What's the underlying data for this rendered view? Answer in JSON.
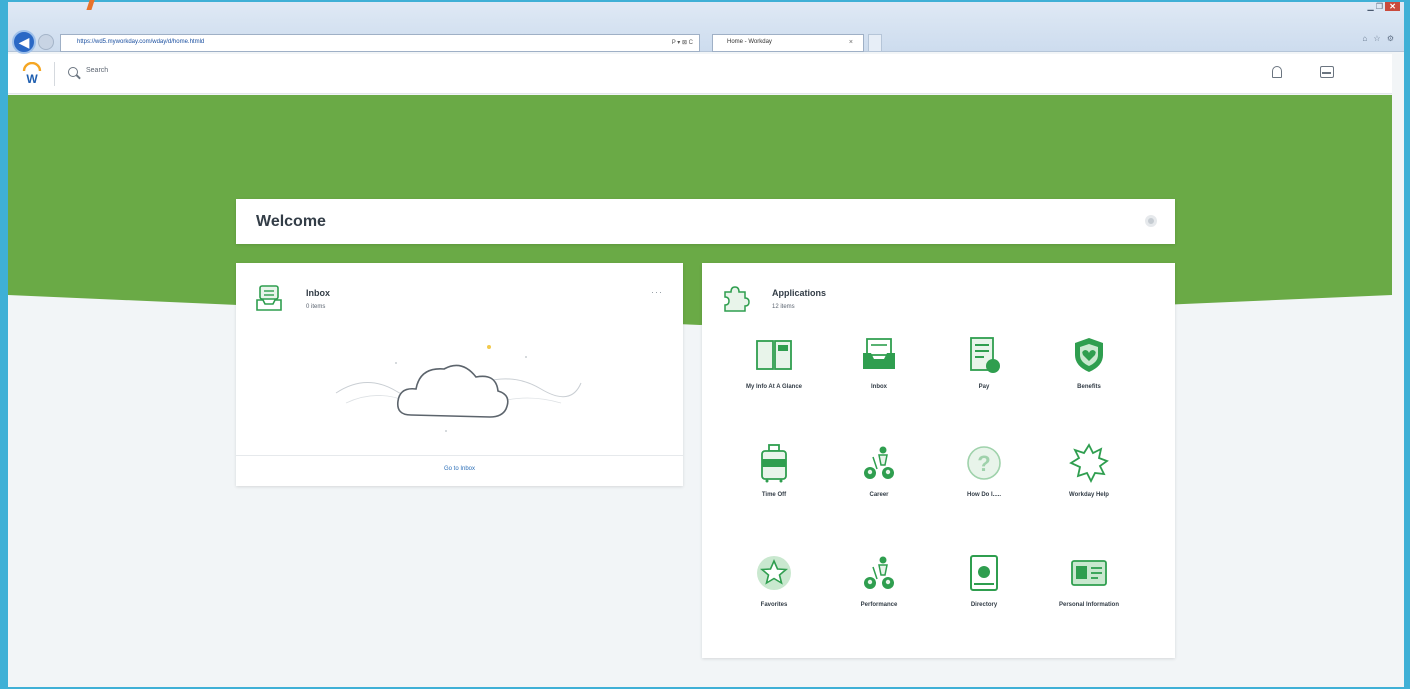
{
  "browser": {
    "url": "https://wd5.myworkday.com/wday/d/home.htmld",
    "tab_title": "Home - Workday",
    "tab_close": "×",
    "addr_tools": "P ▾ ⊠ C",
    "window_close": "✕"
  },
  "header": {
    "search_label": "Search"
  },
  "welcome": {
    "title": "Welcome"
  },
  "inbox_card": {
    "title": "Inbox",
    "subtitle": "0 items",
    "more": "···",
    "link": "Go to Inbox"
  },
  "apps_card": {
    "title": "Applications",
    "subtitle": "12 items",
    "apps": [
      {
        "label": "My Info At A Glance",
        "icon": "book-icon"
      },
      {
        "label": "Inbox",
        "icon": "inbox-tray-icon"
      },
      {
        "label": "Pay",
        "icon": "pay-icon"
      },
      {
        "label": "Benefits",
        "icon": "shield-heart-icon"
      },
      {
        "label": "Time Off",
        "icon": "luggage-icon"
      },
      {
        "label": "Career",
        "icon": "people-ladder-icon"
      },
      {
        "label": "How Do I.....",
        "icon": "question-icon"
      },
      {
        "label": "Workday Help",
        "icon": "sunburst-icon"
      },
      {
        "label": "Favorites",
        "icon": "star-icon"
      },
      {
        "label": "Performance",
        "icon": "people-ladder-icon"
      },
      {
        "label": "Directory",
        "icon": "phone-directory-icon"
      },
      {
        "label": "Personal Information",
        "icon": "id-card-icon"
      }
    ]
  },
  "colors": {
    "banner": "#6aaa46",
    "app_icon_green": "#2f9e4f",
    "link_blue": "#2c6fb8"
  }
}
